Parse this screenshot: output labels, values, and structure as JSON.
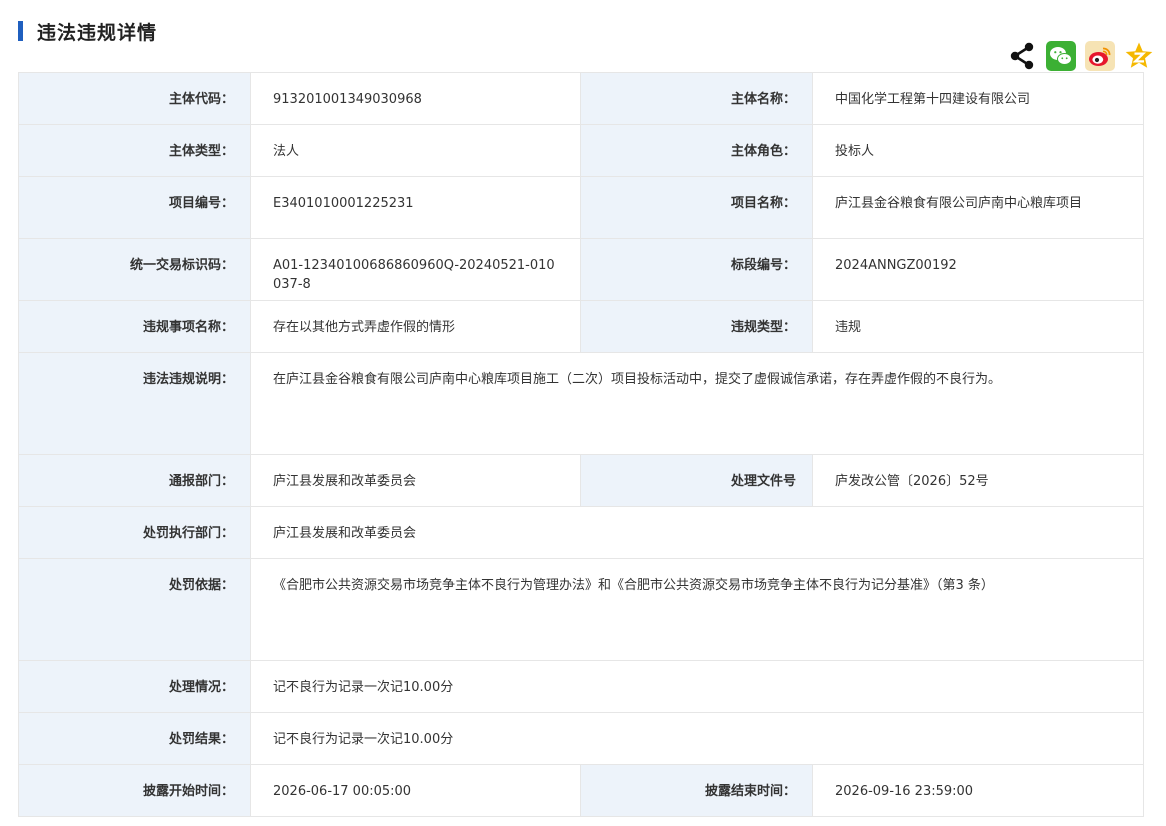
{
  "header": {
    "title": "违法违规详情"
  },
  "share": {
    "icons": [
      "share-icon",
      "wechat-icon",
      "weibo-icon",
      "qzone-icon"
    ],
    "colors": {
      "wechat": "#3cb034",
      "weibo": "#e6162d",
      "qzone": "#f5b800"
    }
  },
  "accent_color": "#1f5fbf",
  "label_bg": "#edf3fa",
  "rows": {
    "subject_code": {
      "label": "主体代码：",
      "value": "913201001349030968"
    },
    "subject_name": {
      "label": "主体名称：",
      "value": "中国化学工程第十四建设有限公司"
    },
    "subject_type": {
      "label": "主体类型：",
      "value": "法人"
    },
    "subject_role": {
      "label": "主体角色：",
      "value": "投标人"
    },
    "project_no": {
      "label": "项目编号：",
      "value": "E3401010001225231"
    },
    "project_name": {
      "label": "项目名称：",
      "value": "庐江县金谷粮食有限公司庐南中心粮库项目"
    },
    "trade_id": {
      "label": "统一交易标识码：",
      "value": "A01-12340100686860960Q-20240521-010037-8"
    },
    "section_no": {
      "label": "标段编号：",
      "value": "2024ANNGZ00192"
    },
    "violation_item": {
      "label": "违规事项名称：",
      "value": "存在以其他方式弄虚作假的情形"
    },
    "violation_type": {
      "label": "违规类型：",
      "value": "违规"
    },
    "violation_desc": {
      "label": "违法违规说明：",
      "value": "在庐江县金谷粮食有限公司庐南中心粮库项目施工（二次）项目投标活动中，提交了虚假诚信承诺，存在弄虚作假的不良行为。"
    },
    "report_dept": {
      "label": "通报部门：",
      "value": "庐江县发展和改革委员会"
    },
    "doc_no": {
      "label": "处理文件号",
      "value": "庐发改公管〔2026〕52号"
    },
    "exec_dept": {
      "label": "处罚执行部门：",
      "value": "庐江县发展和改革委员会"
    },
    "basis": {
      "label": "处罚依据：",
      "value": "《合肥市公共资源交易市场竞争主体不良行为管理办法》和《合肥市公共资源交易市场竞争主体不良行为记分基准》（第3 条）"
    },
    "handling": {
      "label": "处理情况：",
      "value": "记不良行为记录一次记10.00分"
    },
    "result": {
      "label": "处罚结果：",
      "value": "记不良行为记录一次记10.00分"
    },
    "start_time": {
      "label": "披露开始时间：",
      "value": "2026-06-17 00:05:00"
    },
    "end_time": {
      "label": "披露结束时间：",
      "value": "2026-09-16 23:59:00"
    }
  }
}
